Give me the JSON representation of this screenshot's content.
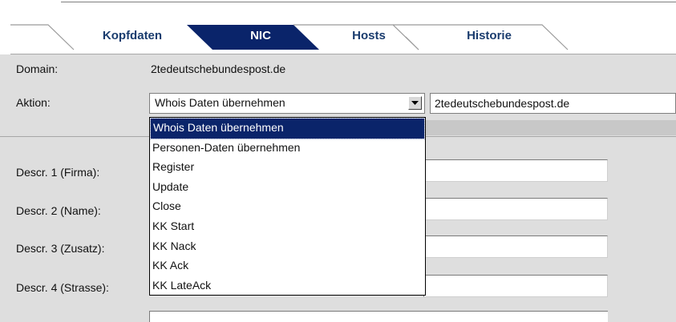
{
  "tabs": [
    {
      "label": "Kopfdaten",
      "active": false
    },
    {
      "label": "NIC",
      "active": true
    },
    {
      "label": "Hosts",
      "active": false
    },
    {
      "label": "Historie",
      "active": false
    }
  ],
  "form": {
    "domain_label": "Domain:",
    "domain_value": "2tedeutschebundespost.de",
    "aktion_label": "Aktion:",
    "aktion_selected": "Whois Daten übernehmen",
    "aktion_text_value": "2tedeutschebundespost.de",
    "fields": [
      {
        "label": "Descr. 1 (Firma):",
        "value": ""
      },
      {
        "label": "Descr. 2 (Name):",
        "value": ""
      },
      {
        "label": "Descr. 3 (Zusatz):",
        "value": ""
      },
      {
        "label": "Descr. 4 (Strasse):",
        "value": ""
      }
    ]
  },
  "dropdown": {
    "options": [
      "Whois Daten übernehmen",
      "Personen-Daten übernehmen",
      "Register",
      "Update",
      "Close",
      "KK Start",
      "KK Nack",
      "KK Ack",
      "KK LateAck"
    ],
    "selected_index": 0
  },
  "colors": {
    "active_tab": "#0a246a",
    "inactive_tab_text": "#1a3c6e",
    "selection": "#0a246a",
    "background": "#dedede"
  }
}
